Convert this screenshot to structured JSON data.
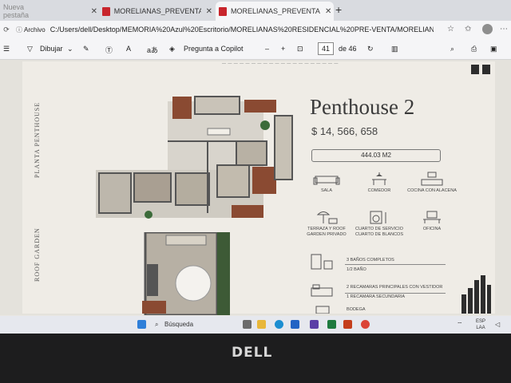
{
  "browser": {
    "tabs": [
      {
        "label": "Nueva pestaña"
      },
      {
        "label": "MORELIANAS_PREVENTA RESIDENC"
      },
      {
        "label": "MORELIANAS_PREVENTA RESIDENC"
      }
    ],
    "address": {
      "info_label": "Archivo",
      "url": "C:/Users/dell/Desktop/MEMORIA%20Azul%20Escritorio/MORELIANAS%20RESIDENCIAL%20PRE-VENTA/MORELIANAS_PREVENTA%..."
    }
  },
  "pdf_toolbar": {
    "draw_label": "Dibujar",
    "copilot_label": "Pregunta a Copilot",
    "page_current": "41",
    "page_total": "de 46"
  },
  "document": {
    "side_label_top": "PLANTA PENTHOUSE",
    "side_label_bottom": "ROOF GARDEN",
    "title": "Penthouse 2",
    "price": "$ 14, 566, 658",
    "area": "444.03 M2",
    "amenities": [
      {
        "label": "SALA",
        "icon": "sofa-icon"
      },
      {
        "label": "COMEDOR",
        "icon": "dining-table-icon"
      },
      {
        "label": "COCINA CON ALACENA",
        "icon": "kitchen-icon"
      },
      {
        "label": "TERRAZA Y ROOF GARDEN PRIVADO",
        "icon": "terrace-icon"
      },
      {
        "label": "CUARTO DE SERVICIO CUARTO DE BLANCOS",
        "icon": "laundry-icon"
      },
      {
        "label": "OFICINA",
        "icon": "desk-icon"
      }
    ],
    "features": [
      {
        "line1": "3 BAÑOS COMPLETOS",
        "line2": "1/2 BAÑO",
        "icon": "bathroom-icon"
      },
      {
        "line1": "2 RECAMARAS PRINCIPALES CON VESTIDOR",
        "line2": "1 RECAMARA SECUNDARIA",
        "icon": "bed-icon"
      },
      {
        "line1": "BODEGA",
        "line2": "",
        "icon": "storage-icon"
      }
    ]
  },
  "taskbar": {
    "search_label": "Búsqueda",
    "lang_top": "ESP",
    "lang_bottom": "LAA"
  },
  "bezel": {
    "brand": "DELL"
  }
}
